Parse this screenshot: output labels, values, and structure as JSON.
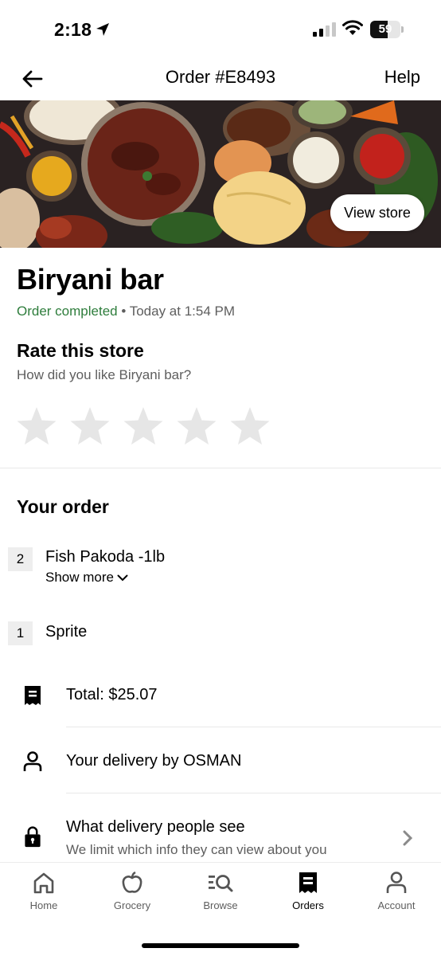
{
  "status_bar": {
    "time": "2:18",
    "battery": "59",
    "battery_level": 0.59
  },
  "header": {
    "title": "Order #E8493",
    "help_label": "Help"
  },
  "hero": {
    "view_store_label": "View store"
  },
  "store": {
    "name": "Biryani bar",
    "status": "Order completed",
    "separator": " • ",
    "time": "Today at 1:54 PM"
  },
  "rating": {
    "title": "Rate this store",
    "question": "How did you like Biryani bar?",
    "max_stars": 5,
    "selected_stars": 0
  },
  "order": {
    "title": "Your order",
    "items": [
      {
        "qty": "2",
        "name": "Fish Pakoda -1lb",
        "show_more": "Show more"
      },
      {
        "qty": "1",
        "name": "Sprite"
      }
    ],
    "total": "Total: $25.07",
    "delivery": "Your delivery by OSMAN",
    "privacy_title": "What delivery people see",
    "privacy_subtitle": "We limit which info they can view about you"
  },
  "tabs": [
    {
      "label": "Home",
      "icon": "home-icon"
    },
    {
      "label": "Grocery",
      "icon": "apple-icon"
    },
    {
      "label": "Browse",
      "icon": "browse-search-icon"
    },
    {
      "label": "Orders",
      "icon": "receipt-icon",
      "active": true
    },
    {
      "label": "Account",
      "icon": "person-icon"
    }
  ],
  "colors": {
    "accent_green": "#2e7d3c",
    "star_empty": "#e6e6e6",
    "secondary_text": "#5e5e5e"
  }
}
